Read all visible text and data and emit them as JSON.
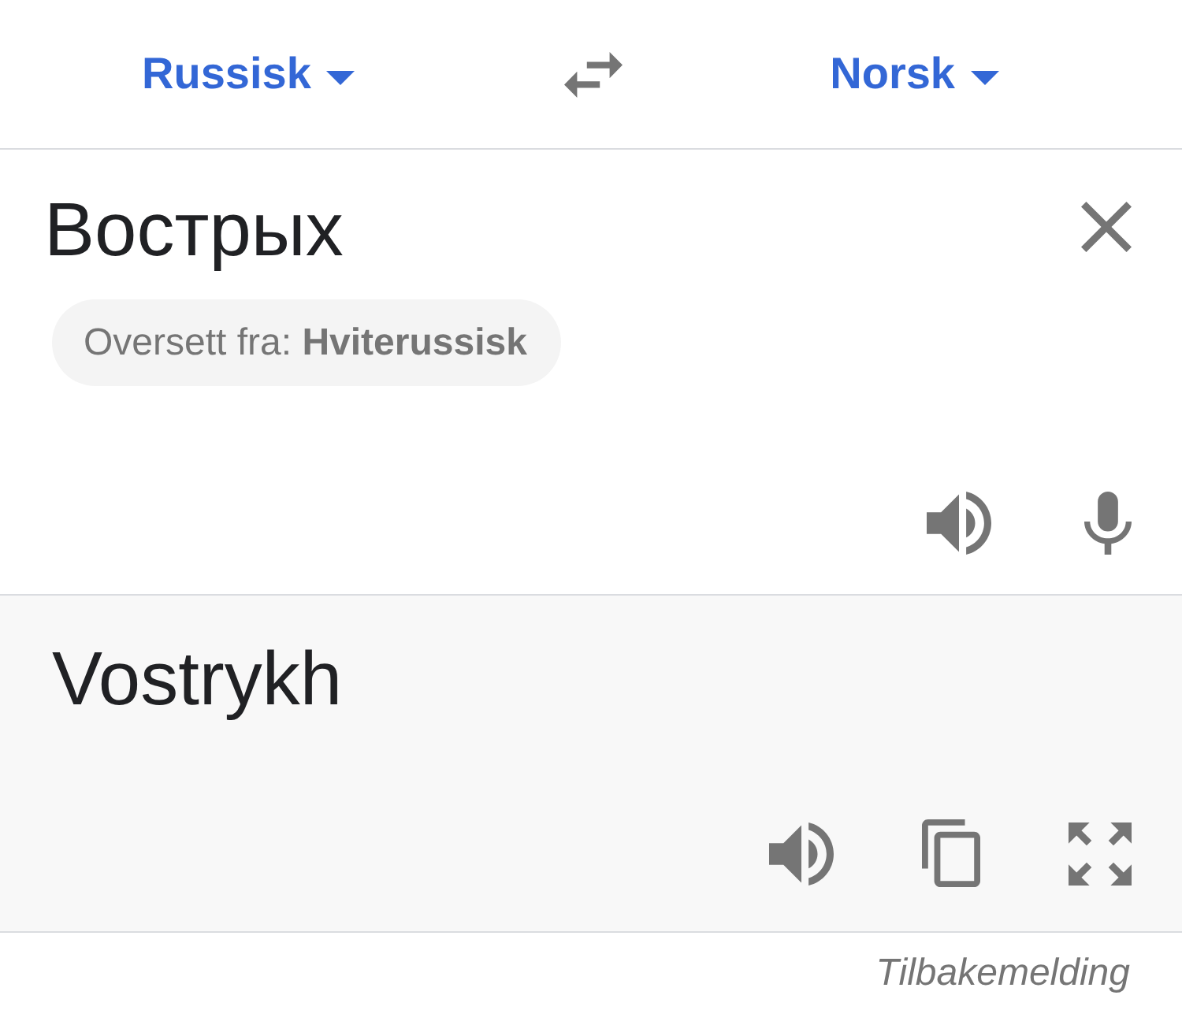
{
  "header": {
    "source_language": {
      "label": "Russisk"
    },
    "target_language": {
      "label": "Norsk"
    }
  },
  "source": {
    "text": "Вострых",
    "detected_language": "Oversett fra: **Hviterussisk**"
  },
  "output": {
    "text": "Vostrykh"
  },
  "footer": {
    "feedback_link": "Tilbakemelding"
  }
}
